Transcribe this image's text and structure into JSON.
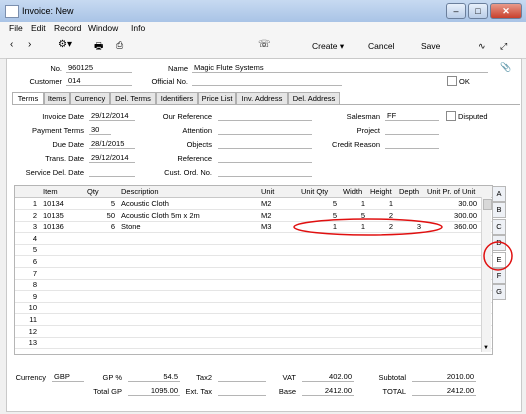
{
  "window": {
    "title": "Invoice: New"
  },
  "menu": [
    "File",
    "Edit",
    "Record",
    "Window",
    "Info"
  ],
  "toolbar": {
    "create": "Create",
    "cancel": "Cancel",
    "save": "Save"
  },
  "header": {
    "no_label": "No.",
    "no_value": "960125",
    "name_label": "Name",
    "name_value": "Magic Flute Systems",
    "customer_label": "Customer",
    "customer_value": "014",
    "official_label": "Official No.",
    "official_value": "",
    "ok_label": "OK"
  },
  "tabs": [
    "Terms",
    "Items",
    "Currency",
    "Del. Terms",
    "Identifiers",
    "Price List",
    "Inv. Address",
    "Del. Address"
  ],
  "terms": {
    "invoice_date_label": "Invoice Date",
    "invoice_date": "29/12/2014",
    "payment_terms_label": "Payment Terms",
    "payment_terms": "30",
    "due_date_label": "Due Date",
    "due_date": "28/1/2015",
    "trans_date_label": "Trans. Date",
    "trans_date": "29/12/2014",
    "service_del_label": "Service Del. Date",
    "service_del": "",
    "our_ref_label": "Our Reference",
    "attention_label": "Attention",
    "objects_label": "Objects",
    "reference_label": "Reference",
    "cust_ord_label": "Cust. Ord. No.",
    "salesman_label": "Salesman",
    "salesman": "FF",
    "project_label": "Project",
    "credit_reason_label": "Credit Reason",
    "disputed_label": "Disputed"
  },
  "grid": {
    "headers": [
      "Item",
      "Qty",
      "Description",
      "Unit",
      "Unit Qty",
      "Width",
      "Height",
      "Depth",
      "Unit Pr. of Unit"
    ],
    "rows": [
      {
        "n": "1",
        "item": "10134",
        "qty": "5",
        "desc": "Acoustic Cloth",
        "unit": "M2",
        "uqty": "5",
        "width": "1",
        "height": "1",
        "depth": "",
        "price": "30.00"
      },
      {
        "n": "2",
        "item": "10135",
        "qty": "50",
        "desc": "Acoustic Cloth 5m x 2m",
        "unit": "M2",
        "uqty": "5",
        "width": "5",
        "height": "2",
        "depth": "",
        "price": "300.00"
      },
      {
        "n": "3",
        "item": "10136",
        "qty": "6",
        "desc": "Stone",
        "unit": "M3",
        "uqty": "1",
        "width": "1",
        "height": "2",
        "depth": "3",
        "price": "360.00"
      },
      {
        "n": "4"
      },
      {
        "n": "5"
      },
      {
        "n": "6"
      },
      {
        "n": "7"
      },
      {
        "n": "8"
      },
      {
        "n": "9"
      },
      {
        "n": "10"
      },
      {
        "n": "11"
      },
      {
        "n": "12"
      },
      {
        "n": "13"
      }
    ]
  },
  "side_tabs": [
    "A",
    "B",
    "C",
    "D",
    "E",
    "F",
    "G"
  ],
  "footer": {
    "currency_label": "Currency",
    "currency": "GBP",
    "gp_pct_label": "GP %",
    "gp_pct": "54.5",
    "total_gp_label": "Total GP",
    "total_gp": "1095.00",
    "tax2_label": "Tax2",
    "ext_tax_label": "Ext. Tax",
    "vat_label": "VAT",
    "vat": "402.00",
    "base_label": "Base",
    "base": "2412.00",
    "subtotal_label": "Subtotal",
    "subtotal": "2010.00",
    "total_label": "TOTAL",
    "total": "2412.00"
  },
  "colors": {
    "annotation": "#e01010",
    "title_bar": "#b8cfee"
  }
}
